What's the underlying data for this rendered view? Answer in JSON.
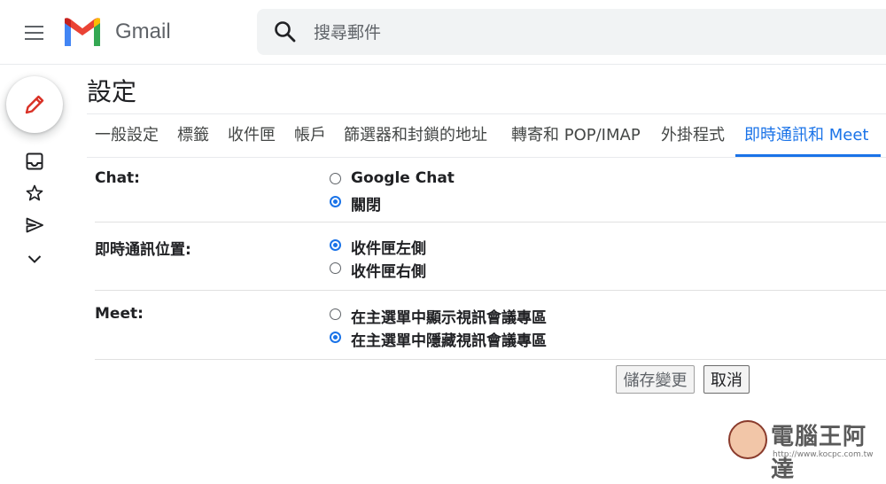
{
  "header": {
    "app_name": "Gmail",
    "search_placeholder": "搜尋郵件"
  },
  "page": {
    "title": "設定"
  },
  "tabs": [
    {
      "label": "一般設定"
    },
    {
      "label": "標籤"
    },
    {
      "label": "收件匣"
    },
    {
      "label": "帳戶"
    },
    {
      "label": "篩選器和封鎖的地址"
    },
    {
      "label": "轉寄和 POP/IMAP"
    },
    {
      "label": "外掛程式"
    },
    {
      "label": "即時通訊和 Meet",
      "active": true
    }
  ],
  "settings": {
    "chat": {
      "label": "Chat:",
      "options": [
        {
          "label": "Google Chat",
          "checked": false
        },
        {
          "label": "關閉",
          "checked": true
        }
      ]
    },
    "chat_position": {
      "label": "即時通訊位置:",
      "options": [
        {
          "label": "收件匣左側",
          "checked": true
        },
        {
          "label": "收件匣右側",
          "checked": false
        }
      ]
    },
    "meet": {
      "label": "Meet:",
      "options": [
        {
          "label": "在主選單中顯示視訊會議專區",
          "checked": false
        },
        {
          "label": "在主選單中隱藏視訊會議專區",
          "checked": true
        }
      ]
    }
  },
  "buttons": {
    "save_label": "儲存變更",
    "cancel_label": "取消"
  },
  "watermark": {
    "text": "電腦王阿達",
    "url": "http://www.kocpc.com.tw"
  },
  "colors": {
    "accent": "#1a73e8",
    "compose_pencil": "#d93025"
  },
  "icons": [
    "menu-icon",
    "gmail-logo-icon",
    "search-icon",
    "pencil-icon",
    "inbox-icon",
    "star-icon",
    "send-icon",
    "chevron-down-icon"
  ]
}
